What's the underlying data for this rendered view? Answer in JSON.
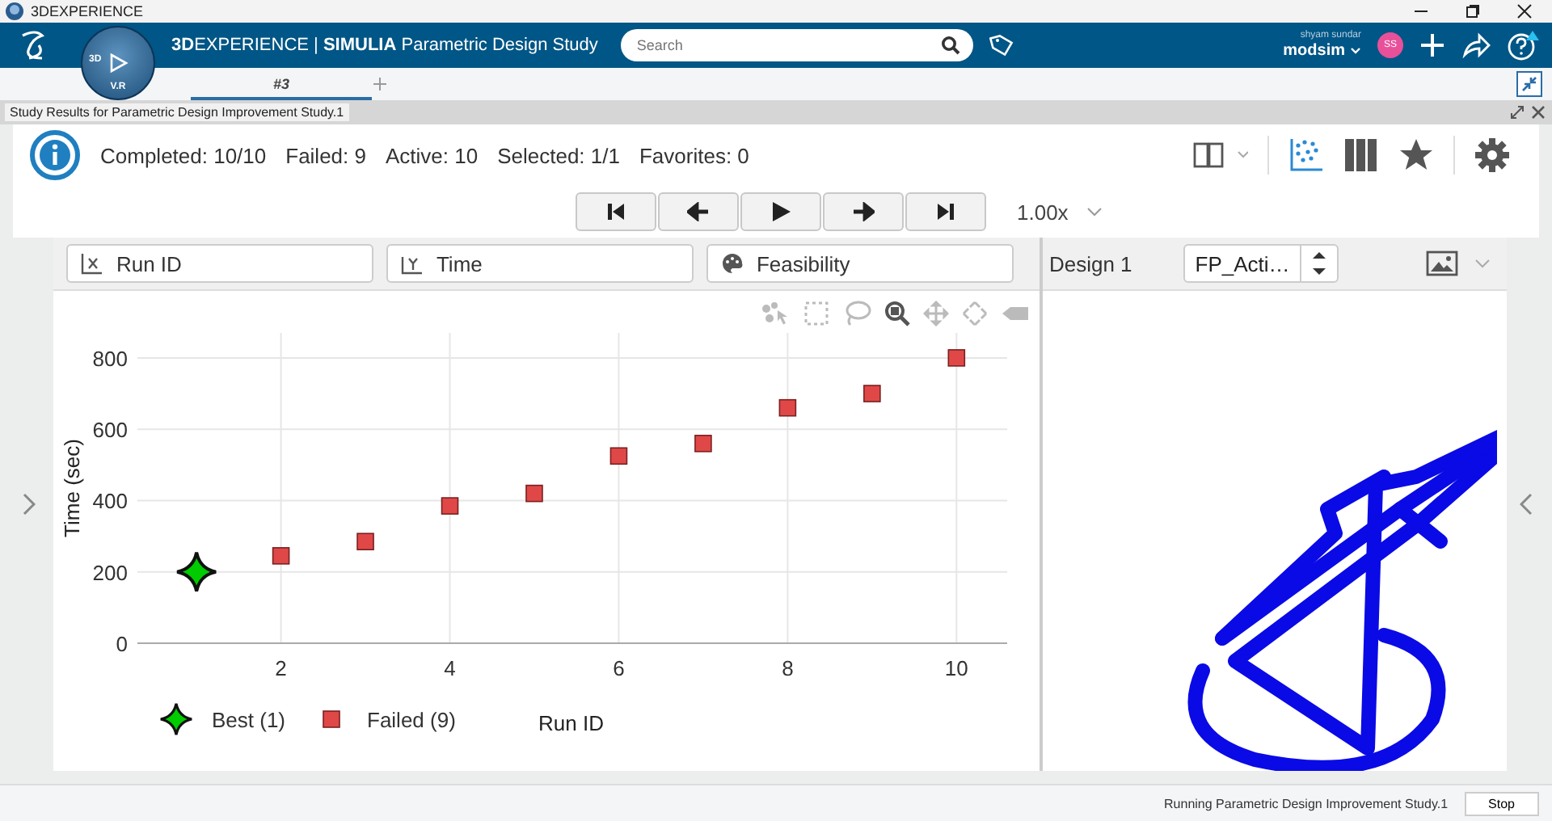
{
  "window": {
    "title": "3DEXPERIENCE"
  },
  "header": {
    "brand": "**3D**EXPERIENCE | **SIMULIA** Parametric Design Study",
    "compass_top": "3D",
    "compass_bottom": "V.R",
    "search": {
      "placeholder": "Search"
    },
    "user": {
      "name": "shyam sundar",
      "tenant": "modsim",
      "initials": "SS"
    }
  },
  "tabs": [
    {
      "label": "#3",
      "selected": true
    }
  ],
  "panel": {
    "title": "Study Results for Parametric Design Improvement Study.1"
  },
  "stats": [
    "Completed: 10/10",
    "Failed: 9",
    "Active: 10",
    "Selected: 1/1",
    "Favorites: 0"
  ],
  "view_buttons": [
    {
      "kind": "scatter",
      "selected": true
    },
    {
      "kind": "columns",
      "selected": false
    },
    {
      "kind": "star",
      "selected": false
    }
  ],
  "speed": "1.00x",
  "axis_fields": [
    {
      "kind": "x",
      "value": "Run ID"
    },
    {
      "kind": "y",
      "value": "Time"
    },
    {
      "kind": "color",
      "value": "Feasibility"
    }
  ],
  "design": {
    "label": "Design 1",
    "value": "FP_Acti…"
  },
  "chart_data": {
    "type": "scatter",
    "grid": true,
    "legend": true,
    "xlabel": "Run ID",
    "ylabel": "Time (sec)",
    "xlim": [
      0.3,
      10.6
    ],
    "ylim": [
      0,
      870
    ],
    "xticks": [
      2,
      4,
      6,
      8,
      10
    ],
    "yticks": [
      0,
      200,
      400,
      600,
      800
    ],
    "x": [
      1,
      2,
      3,
      4,
      5,
      6,
      7,
      8,
      9,
      10
    ],
    "series": [
      {
        "name": "Best (1)",
        "color": "#00cc00",
        "values": [
          200,
          null,
          null,
          null,
          null,
          null,
          null,
          null,
          null,
          null
        ]
      },
      {
        "name": "Failed (9)",
        "color": "#e04848",
        "values": [
          null,
          245,
          285,
          385,
          420,
          525,
          560,
          660,
          700,
          800
        ]
      }
    ]
  },
  "status": {
    "message": "Running Parametric Design Improvement Study.1",
    "button": "Stop"
  }
}
